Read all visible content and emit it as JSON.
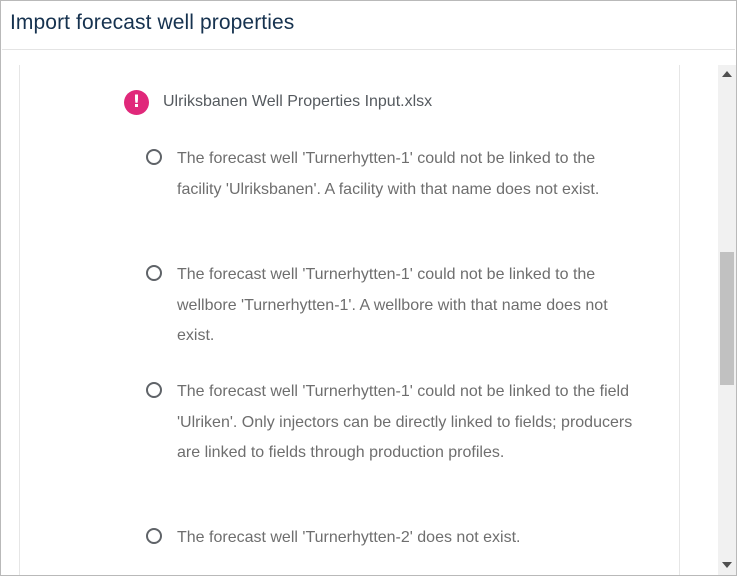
{
  "dialog": {
    "title": "Import forecast well properties"
  },
  "file": {
    "icon": "error-icon",
    "icon_glyph": "!",
    "icon_color": "#e0287a",
    "name": "Ulriksbanen Well Properties Input.xlsx"
  },
  "issues": [
    {
      "text": "The forecast well 'Turnerhytten-1' could not be linked to the facility 'Ulriksbanen'. A facility with that name does not exist."
    },
    {
      "text": "The forecast well 'Turnerhytten-1' could not be linked to the wellbore 'Turnerhytten-1'. A wellbore with that name does not exist."
    },
    {
      "text": "The forecast well 'Turnerhytten-1' could not be linked to the field 'Ulriken'. Only injectors can be directly linked to fields; producers are linked to fields through production profiles."
    },
    {
      "text": "The forecast well 'Turnerhytten-2' does not exist."
    }
  ],
  "scrollbar": {
    "position_fraction": 0.38
  }
}
